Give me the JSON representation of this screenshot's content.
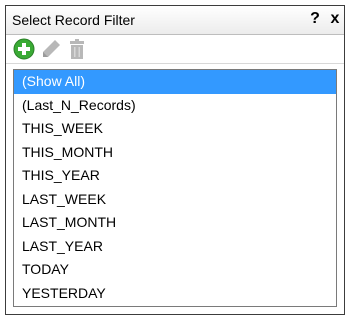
{
  "window": {
    "title": "Select Record Filter",
    "help_label": "?",
    "close_label": "x"
  },
  "toolbar": {
    "add_icon": "add-circle-icon",
    "edit_icon": "pencil-icon",
    "delete_icon": "trash-icon",
    "add_color": "#3aaa35",
    "disabled_color": "#b8b8b8"
  },
  "list": {
    "selected_index": 0,
    "selected_color": "#3399ff",
    "items": [
      {
        "label": "(Show All)"
      },
      {
        "label": "(Last_N_Records)"
      },
      {
        "label": "THIS_WEEK"
      },
      {
        "label": "THIS_MONTH"
      },
      {
        "label": "THIS_YEAR"
      },
      {
        "label": "LAST_WEEK"
      },
      {
        "label": "LAST_MONTH"
      },
      {
        "label": "LAST_YEAR"
      },
      {
        "label": "TODAY"
      },
      {
        "label": "YESTERDAY"
      }
    ]
  }
}
